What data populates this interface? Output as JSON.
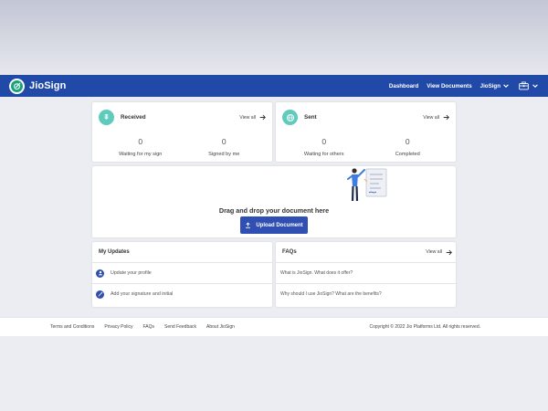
{
  "colors": {
    "nav": "#2149a8",
    "accent_teal": "#5fcbbd",
    "button": "#2f4fb2",
    "logo_green": "#16a37c"
  },
  "brand": {
    "name": "JioSign"
  },
  "nav": {
    "dashboard": "Dashboard",
    "view_documents": "View Documents",
    "user_menu": "JioSign"
  },
  "received": {
    "title": "Received",
    "view_all": "View all",
    "stats": [
      {
        "value": "0",
        "label": "Waiting for my sign"
      },
      {
        "value": "0",
        "label": "Signed by me"
      }
    ]
  },
  "sent": {
    "title": "Sent",
    "view_all": "View all",
    "stats": [
      {
        "value": "0",
        "label": "Waiting for others"
      },
      {
        "value": "0",
        "label": "Completed"
      }
    ]
  },
  "upload": {
    "drop_text": "Drag and drop your document here",
    "button_label": "Upload Document"
  },
  "updates": {
    "title": "My Updates",
    "items": [
      {
        "label": "Update your profile",
        "icon": "user-icon"
      },
      {
        "label": "Add your signature and initial",
        "icon": "pen-icon"
      }
    ]
  },
  "faqs": {
    "title": "FAQs",
    "view_all": "View all",
    "items": [
      {
        "label": "What is JioSign. What does it offer?"
      },
      {
        "label": "Why should I use JioSign? What are the benefits?"
      }
    ]
  },
  "footer": {
    "links": [
      "Terms and Conditions",
      "Privacy Policy",
      "FAQs",
      "Send Feedback",
      "About JioSign"
    ],
    "copyright": "Copyright © 2022 Jio Platforms Ltd. All rights reserved."
  }
}
